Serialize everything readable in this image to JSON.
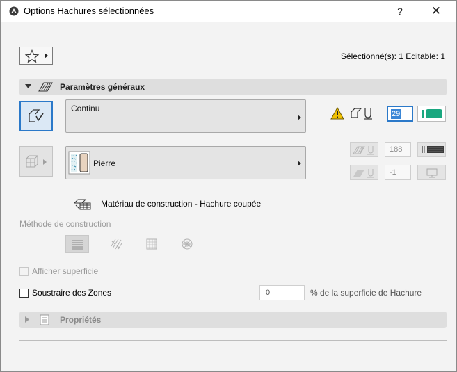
{
  "window": {
    "title": "Options Hachures sélectionnées",
    "help": "?",
    "close": "✕"
  },
  "header": {
    "selection_info": "Sélectionné(s): 1 Editable: 1"
  },
  "sections": {
    "general": {
      "title": "Paramètres généraux",
      "expanded": true
    },
    "properties": {
      "title": "Propriétés",
      "expanded": false
    }
  },
  "line_type": {
    "value": "Continu"
  },
  "material": {
    "value": "Pierre"
  },
  "pen": {
    "number": "29",
    "color": "#1aa77f",
    "background_pen": "188",
    "background_pen_2": "-1"
  },
  "construction_material": {
    "label": "Matériau de construction - Hachure coupée"
  },
  "construction_method": {
    "label": "Méthode de construction"
  },
  "show_area": {
    "label": "Afficher superficie",
    "checked": false,
    "enabled": false
  },
  "subtract_zones": {
    "label": "Soustraire des Zones",
    "checked": false
  },
  "area_percent": {
    "value": "0",
    "label": "% de la superficie de Hachure"
  },
  "colors": {
    "accent": "#2b79c9",
    "pen_green": "#1aa77f",
    "warning": "#f2c200"
  }
}
